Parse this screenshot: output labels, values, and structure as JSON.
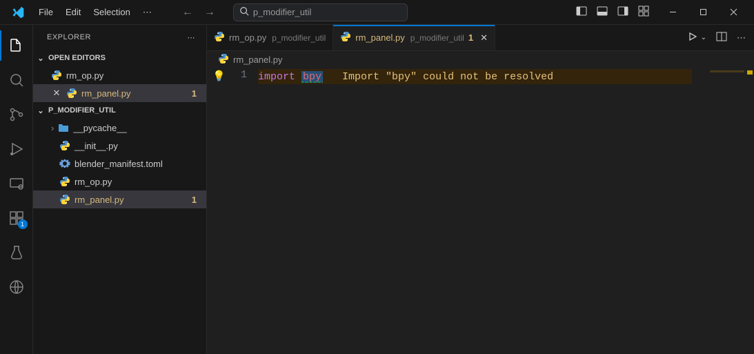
{
  "menu": {
    "file": "File",
    "edit": "Edit",
    "selection": "Selection"
  },
  "search": {
    "placeholder": "p_modifier_util"
  },
  "sidebar": {
    "title": "EXPLORER",
    "open_editors_label": "OPEN EDITORS",
    "open_editors": [
      {
        "name": "rm_op.py",
        "modified": false
      },
      {
        "name": "rm_panel.py",
        "modified": true,
        "badge": "1"
      }
    ],
    "folder_label": "P_MODIFIER_UTIL",
    "tree": {
      "pycache": "__pycache__",
      "init": "__init__.py",
      "manifest": "blender_manifest.toml",
      "rm_op": "rm_op.py",
      "rm_panel": "rm_panel.py",
      "rm_panel_badge": "1"
    }
  },
  "tabs": [
    {
      "name": "rm_op.py",
      "sub": "p_modifier_util",
      "active": false
    },
    {
      "name": "rm_panel.py",
      "sub": "p_modifier_util",
      "badge": "1",
      "active": true
    }
  ],
  "breadcrumb": {
    "file": "rm_panel.py"
  },
  "code": {
    "line_number": "1",
    "keyword": "import",
    "module": "bpy",
    "warning": "Import \"bpy\" could not be resolved"
  },
  "activity_badge": "1"
}
